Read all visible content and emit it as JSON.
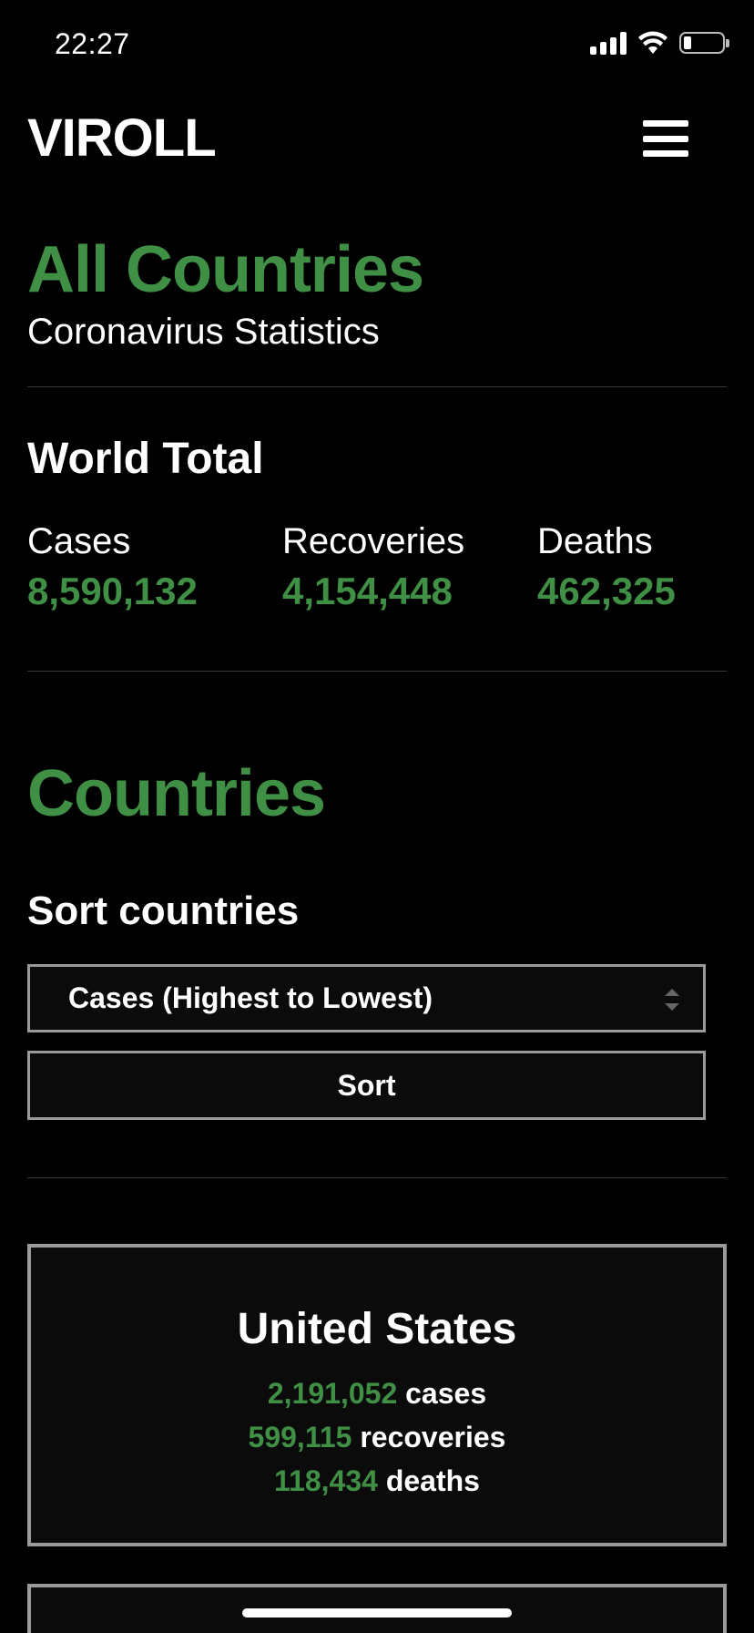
{
  "status_bar": {
    "time": "22:27"
  },
  "header": {
    "logo": "VIROLL",
    "menu_icon": "hamburger-menu-icon"
  },
  "page": {
    "title": "All Countries",
    "subtitle": "Coronavirus Statistics"
  },
  "world_total": {
    "title": "World Total",
    "stats": [
      {
        "label": "Cases",
        "value": "8,590,132"
      },
      {
        "label": "Recoveries",
        "value": "4,154,448"
      },
      {
        "label": "Deaths",
        "value": "462,325"
      }
    ]
  },
  "countries": {
    "title": "Countries",
    "sort_title": "Sort countries",
    "sort_selected": "Cases (Highest to Lowest)",
    "sort_button_label": "Sort",
    "list": [
      {
        "name": "United States",
        "cases": "2,191,052",
        "cases_label": "cases",
        "recoveries": "599,115",
        "recoveries_label": "recoveries",
        "deaths": "118,434",
        "deaths_label": "deaths"
      }
    ]
  },
  "colors": {
    "accent": "#3f8f45",
    "background": "#000000",
    "text": "#ffffff",
    "border": "#9a9a9a"
  }
}
